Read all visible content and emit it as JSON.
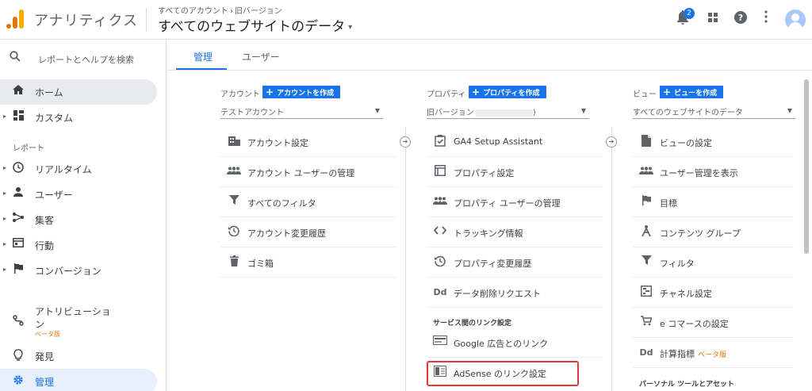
{
  "header": {
    "app_title": "アナリティクス",
    "breadcrumb_root": "すべてのアカウント",
    "breadcrumb_chevron": "›",
    "breadcrumb_child": "旧バージョン",
    "account_name": "すべてのウェブサイトのデータ",
    "account_caret": "▾",
    "notification_count": "2"
  },
  "sidebar": {
    "search_placeholder": "レポートとヘルプを検索",
    "items": [
      {
        "label": "ホーム",
        "icon": "home-icon"
      },
      {
        "label": "カスタム",
        "icon": "dashboard-icon"
      },
      {
        "label": "リアルタイム",
        "icon": "clock-icon"
      },
      {
        "label": "ユーザー",
        "icon": "person-icon"
      },
      {
        "label": "集客",
        "icon": "acquisition-icon"
      },
      {
        "label": "行動",
        "icon": "behavior-icon"
      },
      {
        "label": "コンバージョン",
        "icon": "flag-icon"
      },
      {
        "label": "アトリビューション",
        "icon": "attribution-icon",
        "beta": "ベータ版"
      },
      {
        "label": "発見",
        "icon": "lightbulb-icon"
      },
      {
        "label": "管理",
        "icon": "gear-icon"
      }
    ],
    "reports_section": "レポート"
  },
  "tabs": [
    {
      "label": "管理",
      "active": true
    },
    {
      "label": "ユーザー",
      "active": false
    }
  ],
  "columns": {
    "account": {
      "kind": "アカウント",
      "create_label": "アカウントを作成",
      "selected": "テストアカウント",
      "items": [
        {
          "label": "アカウント設定",
          "icon": "building-icon"
        },
        {
          "label": "アカウント ユーザーの管理",
          "icon": "people-icon"
        },
        {
          "label": "すべてのフィルタ",
          "icon": "filter-icon"
        },
        {
          "label": "アカウント変更履歴",
          "icon": "history-icon"
        },
        {
          "label": "ゴミ箱",
          "icon": "trash-icon"
        }
      ]
    },
    "property": {
      "kind": "プロパティ",
      "create_label": "プロパティを作成",
      "selected_prefix": "旧バージョン",
      "selected_suffix": ")",
      "items": [
        {
          "label": "GA4 Setup Assistant",
          "icon": "checkbox-icon"
        },
        {
          "label": "プロパティ設定",
          "icon": "window-icon"
        },
        {
          "label": "プロパティ ユーザーの管理",
          "icon": "people-icon"
        },
        {
          "label": "トラッキング情報",
          "icon": "code-icon"
        },
        {
          "label": "プロパティ変更履歴",
          "icon": "history-icon"
        },
        {
          "label": "データ削除リクエスト",
          "icon": "dd-icon"
        }
      ],
      "link_section": "サービス間のリンク設定",
      "link_items": [
        {
          "label": "Google 広告とのリンク",
          "icon": "google-ads-icon"
        },
        {
          "label": "AdSense のリンク設定",
          "icon": "adsense-icon"
        }
      ]
    },
    "view": {
      "kind": "ビュー",
      "create_label": "ビューを作成",
      "selected": "すべてのウェブサイトのデータ",
      "items": [
        {
          "label": "ビューの設定",
          "icon": "document-icon"
        },
        {
          "label": "ユーザー管理を表示",
          "icon": "people-icon"
        },
        {
          "label": "目標",
          "icon": "flag-icon"
        },
        {
          "label": "コンテンツ グループ",
          "icon": "content-group-icon"
        },
        {
          "label": "フィルタ",
          "icon": "filter-icon"
        },
        {
          "label": "チャネル設定",
          "icon": "channel-icon"
        },
        {
          "label": "e コマースの設定",
          "icon": "cart-icon"
        },
        {
          "label": "計算指標",
          "icon": "dd-icon",
          "beta": "ベータ版"
        }
      ],
      "personal_section": "パーソナル ツールとアセット"
    }
  },
  "colors": {
    "accent": "#1a73e8",
    "orange": "#e37400",
    "highlight": "#e53935"
  }
}
